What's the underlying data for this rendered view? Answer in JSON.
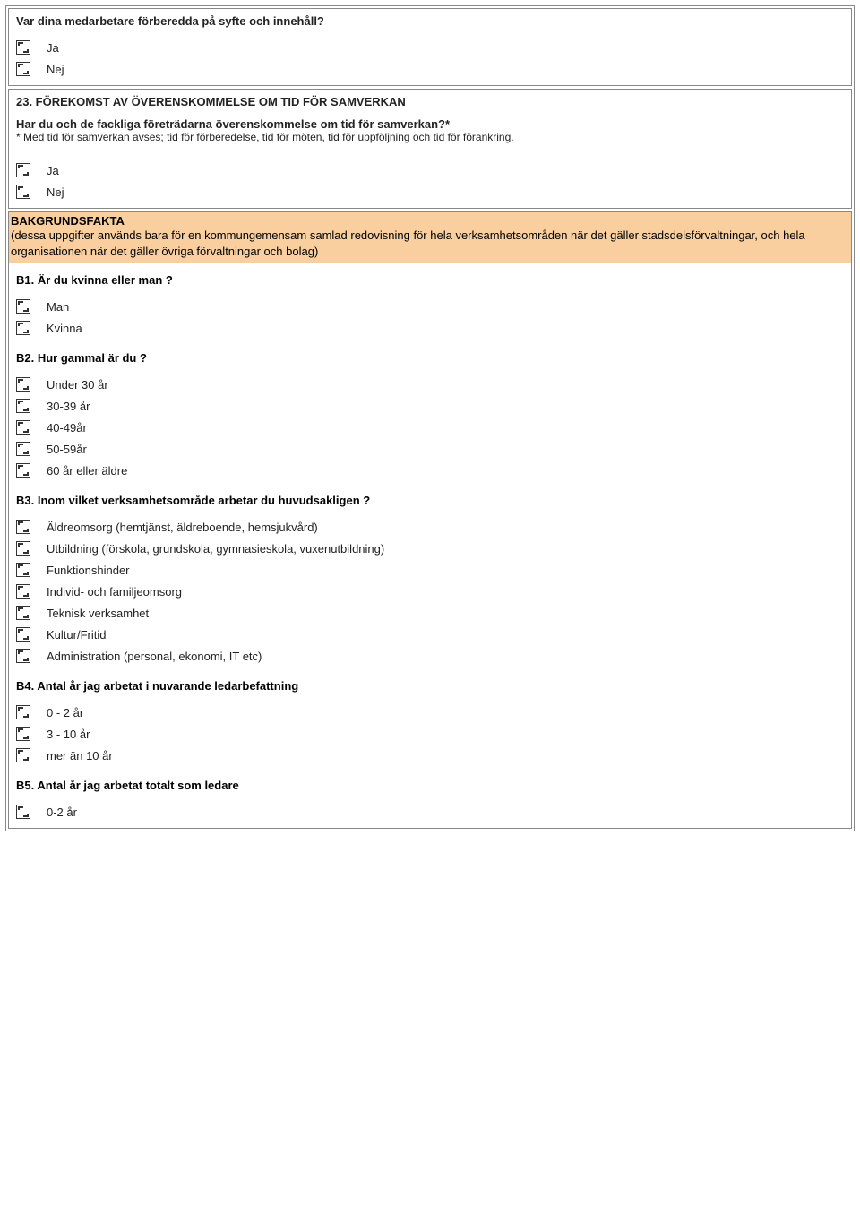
{
  "q_top": {
    "question": "Var dina medarbetare förberedda på syfte och innehåll?",
    "options": [
      "Ja",
      "Nej"
    ]
  },
  "q23": {
    "heading": "23. FÖREKOMST AV ÖVERENSKOMMELSE OM TID  FÖR SAMVERKAN",
    "question": "Har du och de fackliga företrädarna överenskommelse om tid för samverkan?*",
    "note": "* Med tid för samverkan avses; tid för förberedelse, tid för möten, tid för uppföljning och tid för förankring.",
    "options": [
      "Ja",
      "Nej"
    ]
  },
  "bakgrund": {
    "title": "BAKGRUNDSFAKTA",
    "desc": "(dessa uppgifter används bara för en kommungemensam samlad redovisning för hela verksamhetsområden när det gäller stadsdelsförvaltningar, och hela organisationen när det gäller övriga förvaltningar och bolag)",
    "b1": {
      "q": "B1. Är du kvinna eller man ?",
      "options": [
        "Man",
        "Kvinna"
      ]
    },
    "b2": {
      "q": "B2. Hur gammal är du ?",
      "options": [
        "Under 30 år",
        "30-39 år",
        "40-49år",
        "50-59år",
        "60 år eller äldre"
      ]
    },
    "b3": {
      "q": "B3. Inom vilket verksamhetsområde arbetar du huvudsakligen ?",
      "options": [
        "Äldreomsorg (hemtjänst, äldreboende, hemsjukvård)",
        "Utbildning (förskola, grundskola, gymnasieskola, vuxenutbildning)",
        "Funktionshinder",
        "Individ- och familjeomsorg",
        "Teknisk verksamhet",
        "Kultur/Fritid",
        "Administration (personal, ekonomi, IT etc)"
      ]
    },
    "b4": {
      "q": "B4. Antal år jag arbetat i nuvarande ledarbefattning",
      "options": [
        "0 - 2 år",
        "3 - 10 år",
        "mer än 10 år"
      ]
    },
    "b5": {
      "q": "B5. Antal år jag arbetat totalt som ledare",
      "options": [
        "0-2 år"
      ]
    }
  }
}
